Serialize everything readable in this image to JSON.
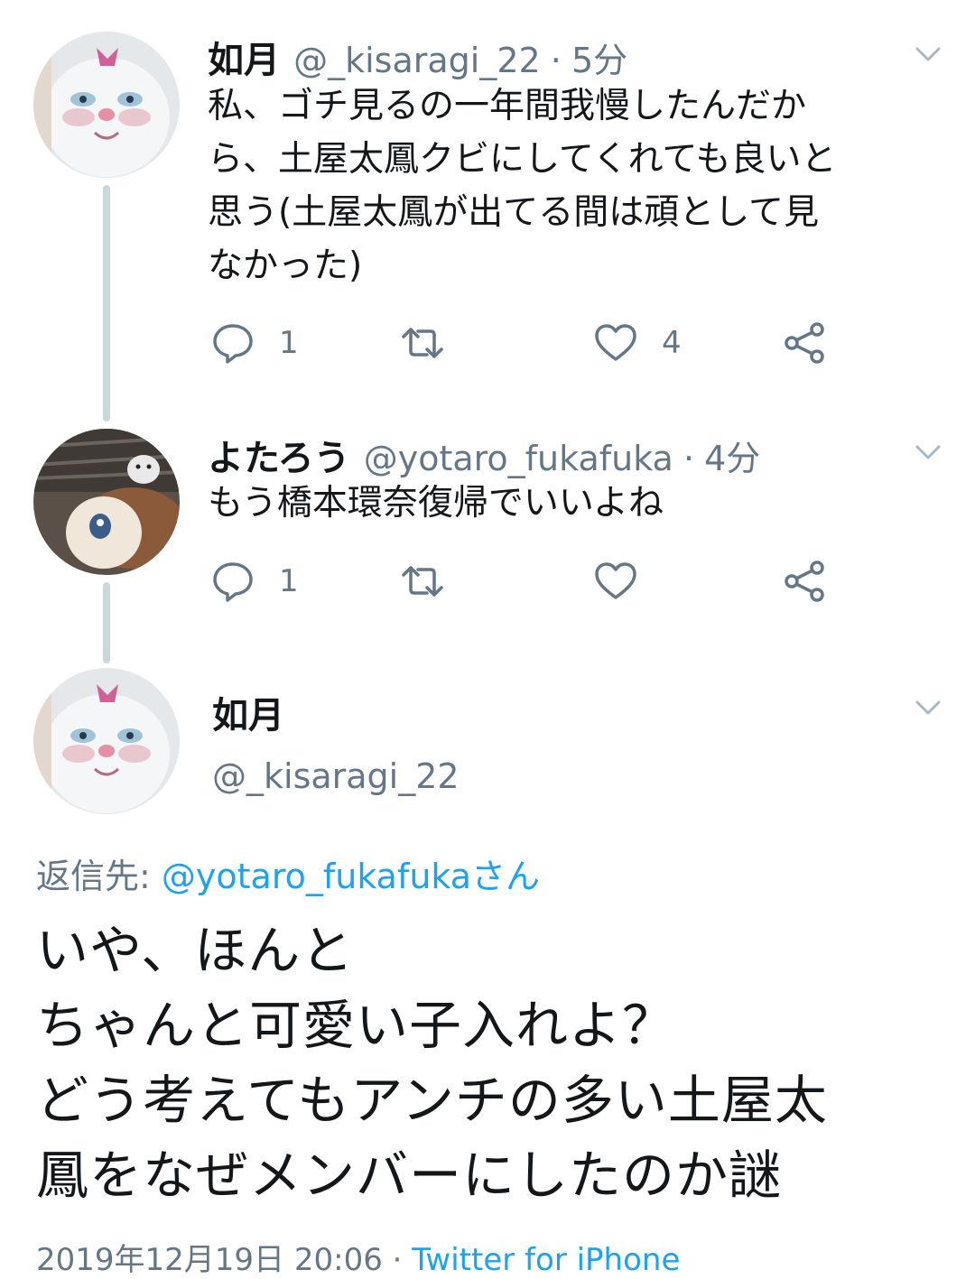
{
  "tweets": [
    {
      "name": "如月",
      "handle": "@_kisaragi_22",
      "time": "5分",
      "text": "私、ゴチ見るの一年間我慢したんだか\nら、土屋太鳳クビにしてくれても良いと\n思う(土屋太鳳が出てる間は頑として見\nなかった)",
      "reply_count": "1",
      "like_count": "4"
    },
    {
      "name": "よたろう",
      "handle": "@yotaro_fukafuka",
      "time": "4分",
      "text": "もう橋本環奈復帰でいいよね",
      "reply_count": "1",
      "like_count": ""
    }
  ],
  "main_tweet": {
    "name": "如月",
    "handle": "@_kisaragi_22",
    "reply_to_label": "返信先:",
    "reply_to_mention": "@yotaro_fukafukaさん",
    "text": "いや、ほんと\nちゃんと可愛い子入れよ？\nどう考えてもアンチの多い土屋太\n鳳をなぜメンバーにしたのか謎",
    "timestamp": "2019年12月19日 20:06 · ",
    "source": "Twitter for iPhone"
  },
  "separator": "·",
  "colors": {
    "accent": "#1da1f2",
    "muted": "#657786",
    "text": "#14171a",
    "thread_line": "#ccd6dd"
  },
  "icons": [
    "reply-icon",
    "retweet-icon",
    "like-icon",
    "share-icon",
    "chevron-down-icon"
  ]
}
